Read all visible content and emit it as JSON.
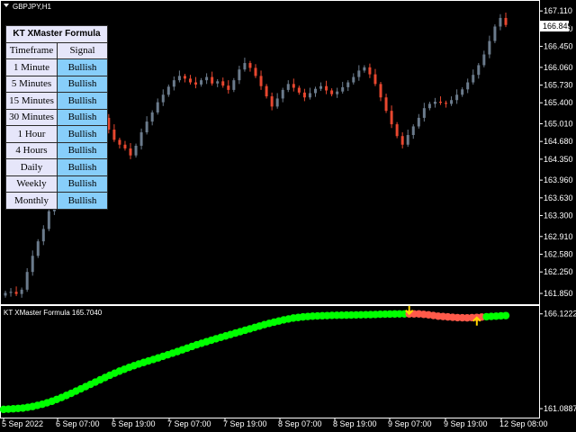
{
  "symbol_label": "GBPJPY,H1",
  "current_price": "166.849",
  "indicator_label": "KT XMaster Formula 165.7040",
  "panel": {
    "title": "KT XMaster Formula",
    "col_timeframe": "Timeframe",
    "col_signal": "Signal",
    "rows": [
      {
        "timeframe": "1 Minute",
        "signal": "Bullish"
      },
      {
        "timeframe": "5 Minutes",
        "signal": "Bullish"
      },
      {
        "timeframe": "15 Minutes",
        "signal": "Bullish"
      },
      {
        "timeframe": "30 Minutes",
        "signal": "Bullish"
      },
      {
        "timeframe": "1 Hour",
        "signal": "Bullish"
      },
      {
        "timeframe": "4 Hours",
        "signal": "Bullish"
      },
      {
        "timeframe": "Daily",
        "signal": "Bullish"
      },
      {
        "timeframe": "Weekly",
        "signal": "Bullish"
      },
      {
        "timeframe": "Monthly",
        "signal": "Bullish"
      }
    ]
  },
  "colors": {
    "bull": "#6b7b8c",
    "bear": "#e8472f",
    "indicator_up": "#00ff00",
    "indicator_down": "#ff5a4a",
    "arrow": "#ffd700"
  },
  "chart_data": {
    "type": "candlestick",
    "price_ticks": [
      "167.110",
      "166.780",
      "166.450",
      "166.060",
      "165.730",
      "165.400",
      "165.010",
      "164.680",
      "164.350",
      "163.960",
      "163.630",
      "163.300",
      "162.910",
      "162.580",
      "162.250",
      "161.850"
    ],
    "price_range": [
      161.75,
      167.18
    ],
    "indicator_ticks": [
      "166.1222",
      "161.0887"
    ],
    "indicator_range": [
      160.9,
      166.3
    ],
    "time_labels": [
      "5 Sep 2022",
      "6 Sep 07:00",
      "6 Sep 19:00",
      "7 Sep 07:00",
      "7 Sep 19:00",
      "8 Sep 07:00",
      "8 Sep 19:00",
      "9 Sep 07:00",
      "9 Sep 19:00",
      "12 Sep 08:00"
    ],
    "closes": [
      161.86,
      161.88,
      161.84,
      161.92,
      162.25,
      162.55,
      162.82,
      163.05,
      163.38,
      163.62,
      163.91,
      164.18,
      164.43,
      164.58,
      164.72,
      164.86,
      165.05,
      164.98,
      165.12,
      164.9,
      164.71,
      164.62,
      164.55,
      164.42,
      164.6,
      164.85,
      165.05,
      165.22,
      165.41,
      165.55,
      165.7,
      165.82,
      165.9,
      165.85,
      165.78,
      165.74,
      165.82,
      165.88,
      165.76,
      165.8,
      165.72,
      165.64,
      165.82,
      166.02,
      166.14,
      166.05,
      165.9,
      165.71,
      165.52,
      165.33,
      165.48,
      165.64,
      165.75,
      165.68,
      165.59,
      165.5,
      165.58,
      165.66,
      165.71,
      165.63,
      165.56,
      165.61,
      165.69,
      165.78,
      165.88,
      166.0,
      166.06,
      165.93,
      165.75,
      165.5,
      165.25,
      165.0,
      164.78,
      164.62,
      164.8,
      164.96,
      165.12,
      165.3,
      165.38,
      165.42,
      165.4,
      165.38,
      165.45,
      165.55,
      165.65,
      165.78,
      165.92,
      166.1,
      166.3,
      166.55,
      166.82,
      166.98,
      166.849
    ],
    "indicator_values": [
      161.05,
      161.08,
      161.12,
      161.2,
      161.32,
      161.48,
      161.68,
      161.9,
      162.14,
      162.38,
      162.62,
      162.86,
      163.08,
      163.28,
      163.46,
      163.62,
      163.78,
      163.95,
      164.12,
      164.3,
      164.48,
      164.64,
      164.8,
      164.95,
      165.1,
      165.25,
      165.4,
      165.55,
      165.68,
      165.8,
      165.9,
      165.96,
      166.0,
      166.02,
      166.04,
      166.05,
      166.06,
      166.07,
      166.08,
      166.1,
      166.11,
      166.12,
      166.12,
      166.12,
      166.07,
      166.0,
      165.96,
      165.92,
      165.91,
      165.93,
      165.97,
      166.0,
      166.03
    ],
    "indicator_signal_start": [
      0,
      0,
      0,
      0,
      0,
      0,
      0,
      0,
      0,
      0,
      0,
      0,
      0,
      0,
      0,
      0,
      0,
      0,
      0,
      0,
      0,
      0,
      0,
      0,
      0,
      0,
      0,
      0,
      0,
      0,
      0,
      0,
      0,
      0,
      0,
      0,
      0,
      0,
      0,
      0,
      0,
      0,
      1,
      1,
      1,
      1,
      1,
      1,
      1,
      1,
      0,
      0,
      0
    ],
    "arrows": [
      {
        "type": "down",
        "bar": 42
      },
      {
        "type": "up",
        "bar": 49
      }
    ]
  }
}
